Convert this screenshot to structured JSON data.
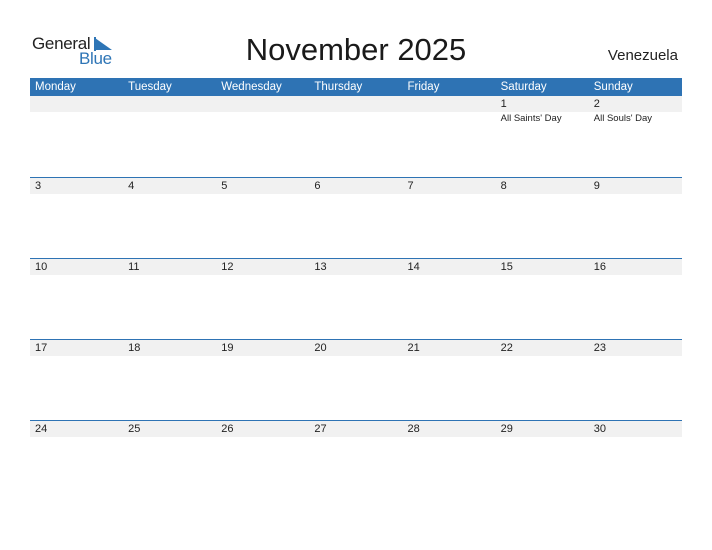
{
  "logo": {
    "word1": "General",
    "word2": "Blue"
  },
  "title": "November 2025",
  "country": "Venezuela",
  "colors": {
    "accent": "#2e73b4",
    "strip": "#f1f1f1"
  },
  "weekdays": [
    "Monday",
    "Tuesday",
    "Wednesday",
    "Thursday",
    "Friday",
    "Saturday",
    "Sunday"
  ],
  "weeks": [
    [
      {
        "day": ""
      },
      {
        "day": ""
      },
      {
        "day": ""
      },
      {
        "day": ""
      },
      {
        "day": ""
      },
      {
        "day": "1",
        "holiday": "All Saints' Day"
      },
      {
        "day": "2",
        "holiday": "All Souls' Day"
      }
    ],
    [
      {
        "day": "3"
      },
      {
        "day": "4"
      },
      {
        "day": "5"
      },
      {
        "day": "6"
      },
      {
        "day": "7"
      },
      {
        "day": "8"
      },
      {
        "day": "9"
      }
    ],
    [
      {
        "day": "10"
      },
      {
        "day": "11"
      },
      {
        "day": "12"
      },
      {
        "day": "13"
      },
      {
        "day": "14"
      },
      {
        "day": "15"
      },
      {
        "day": "16"
      }
    ],
    [
      {
        "day": "17"
      },
      {
        "day": "18"
      },
      {
        "day": "19"
      },
      {
        "day": "20"
      },
      {
        "day": "21"
      },
      {
        "day": "22"
      },
      {
        "day": "23"
      }
    ],
    [
      {
        "day": "24"
      },
      {
        "day": "25"
      },
      {
        "day": "26"
      },
      {
        "day": "27"
      },
      {
        "day": "28"
      },
      {
        "day": "29"
      },
      {
        "day": "30"
      }
    ]
  ]
}
